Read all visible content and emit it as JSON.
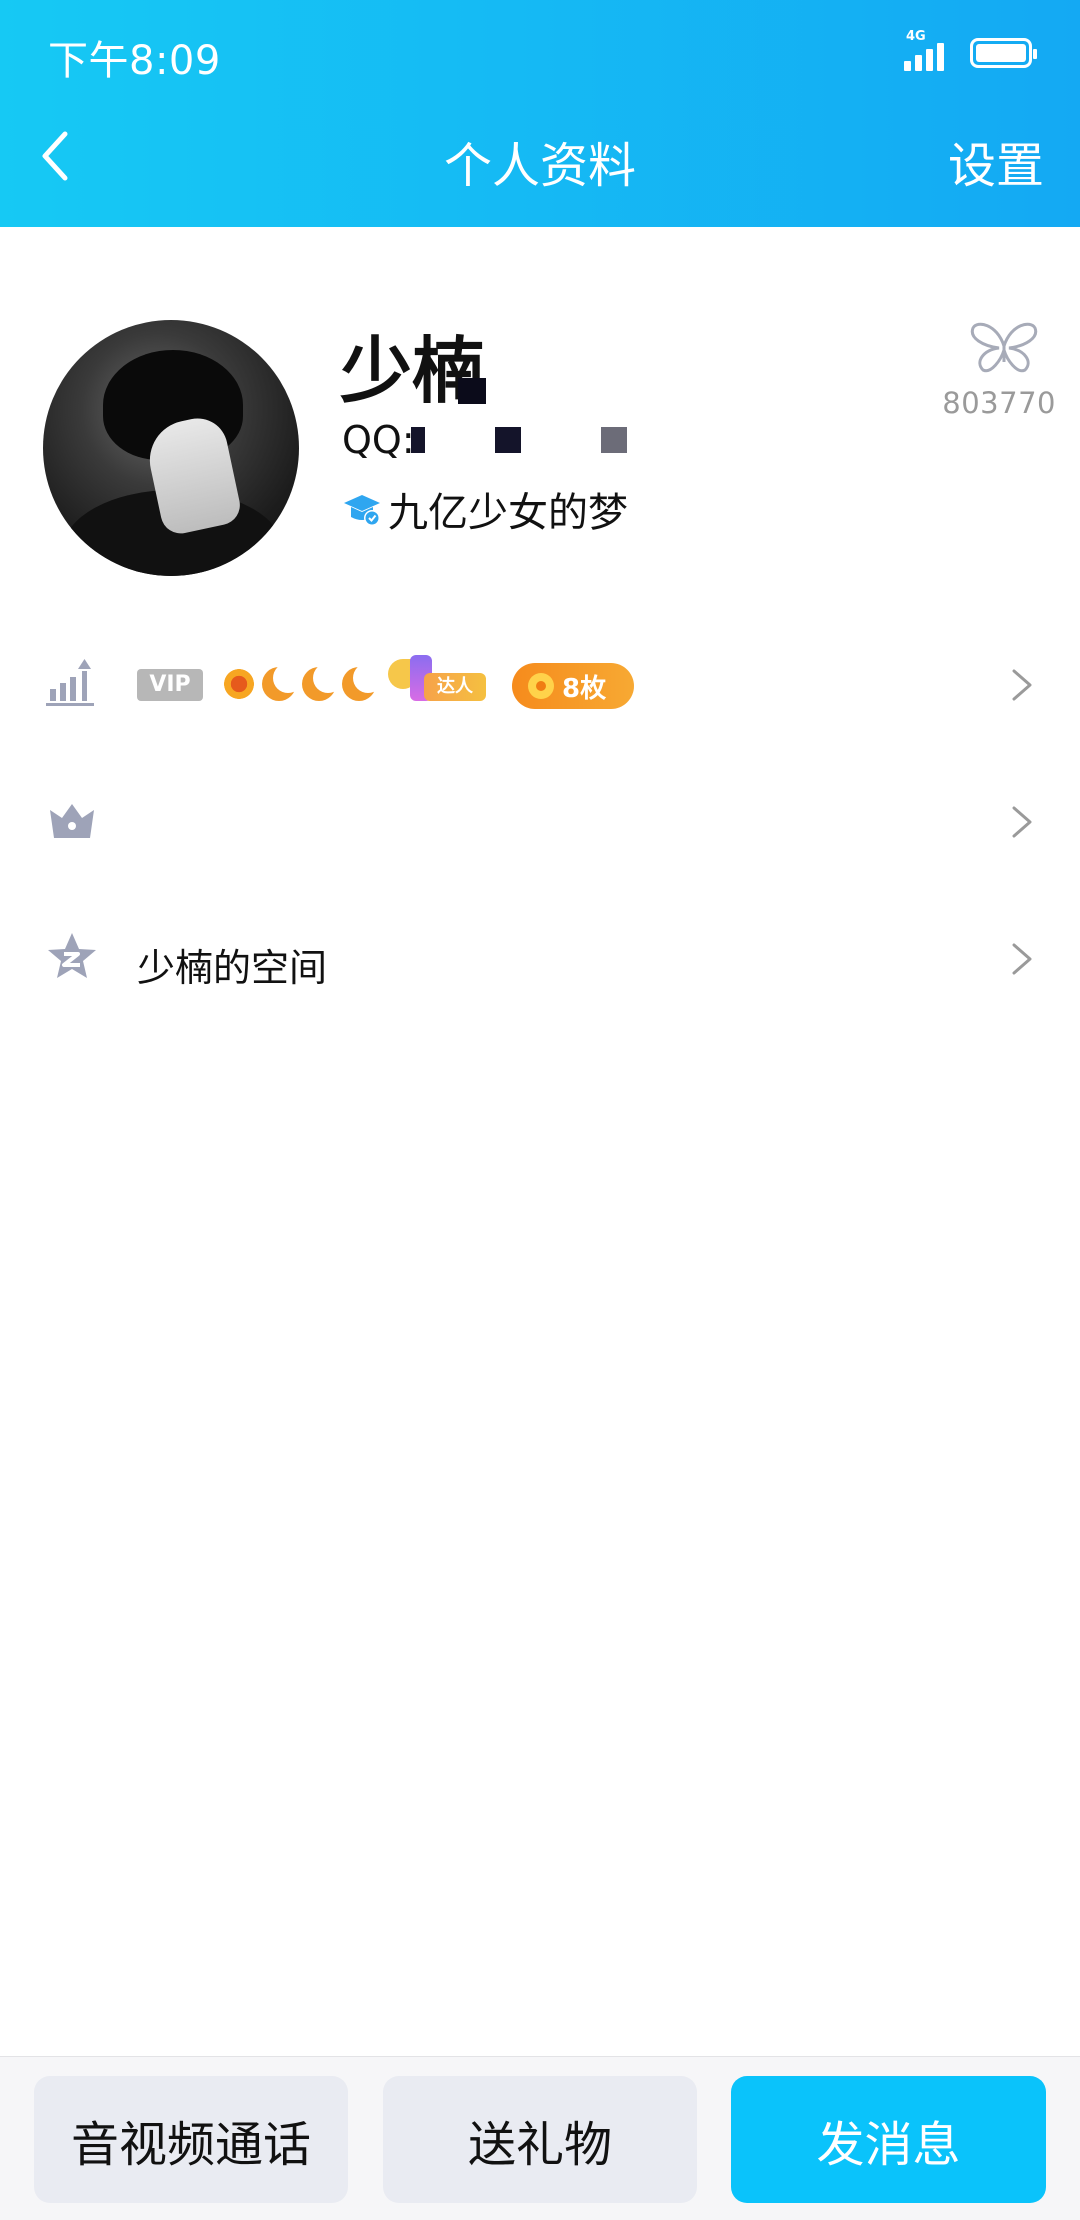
{
  "status_bar": {
    "time": "下午8:09",
    "network": "4G",
    "battery_level": 1.0
  },
  "nav": {
    "title": "个人资料",
    "settings_label": "设置"
  },
  "profile": {
    "name": "少楠",
    "qq_label": "QQ:",
    "signature": "九亿少女的梦",
    "butterfly_count": "803770"
  },
  "rows": {
    "vip_badge": "VIP",
    "daren_tag": "达人",
    "medal_count": "8枚",
    "space_label": "少楠的空间"
  },
  "bottom": {
    "call_label": "音视频通话",
    "gift_label": "送礼物",
    "message_label": "发消息"
  },
  "colors": {
    "header_start": "#16c9f4",
    "header_end": "#14a9f3",
    "primary_button": "#0ac3fb",
    "icon_gray": "#9ea3b8"
  }
}
